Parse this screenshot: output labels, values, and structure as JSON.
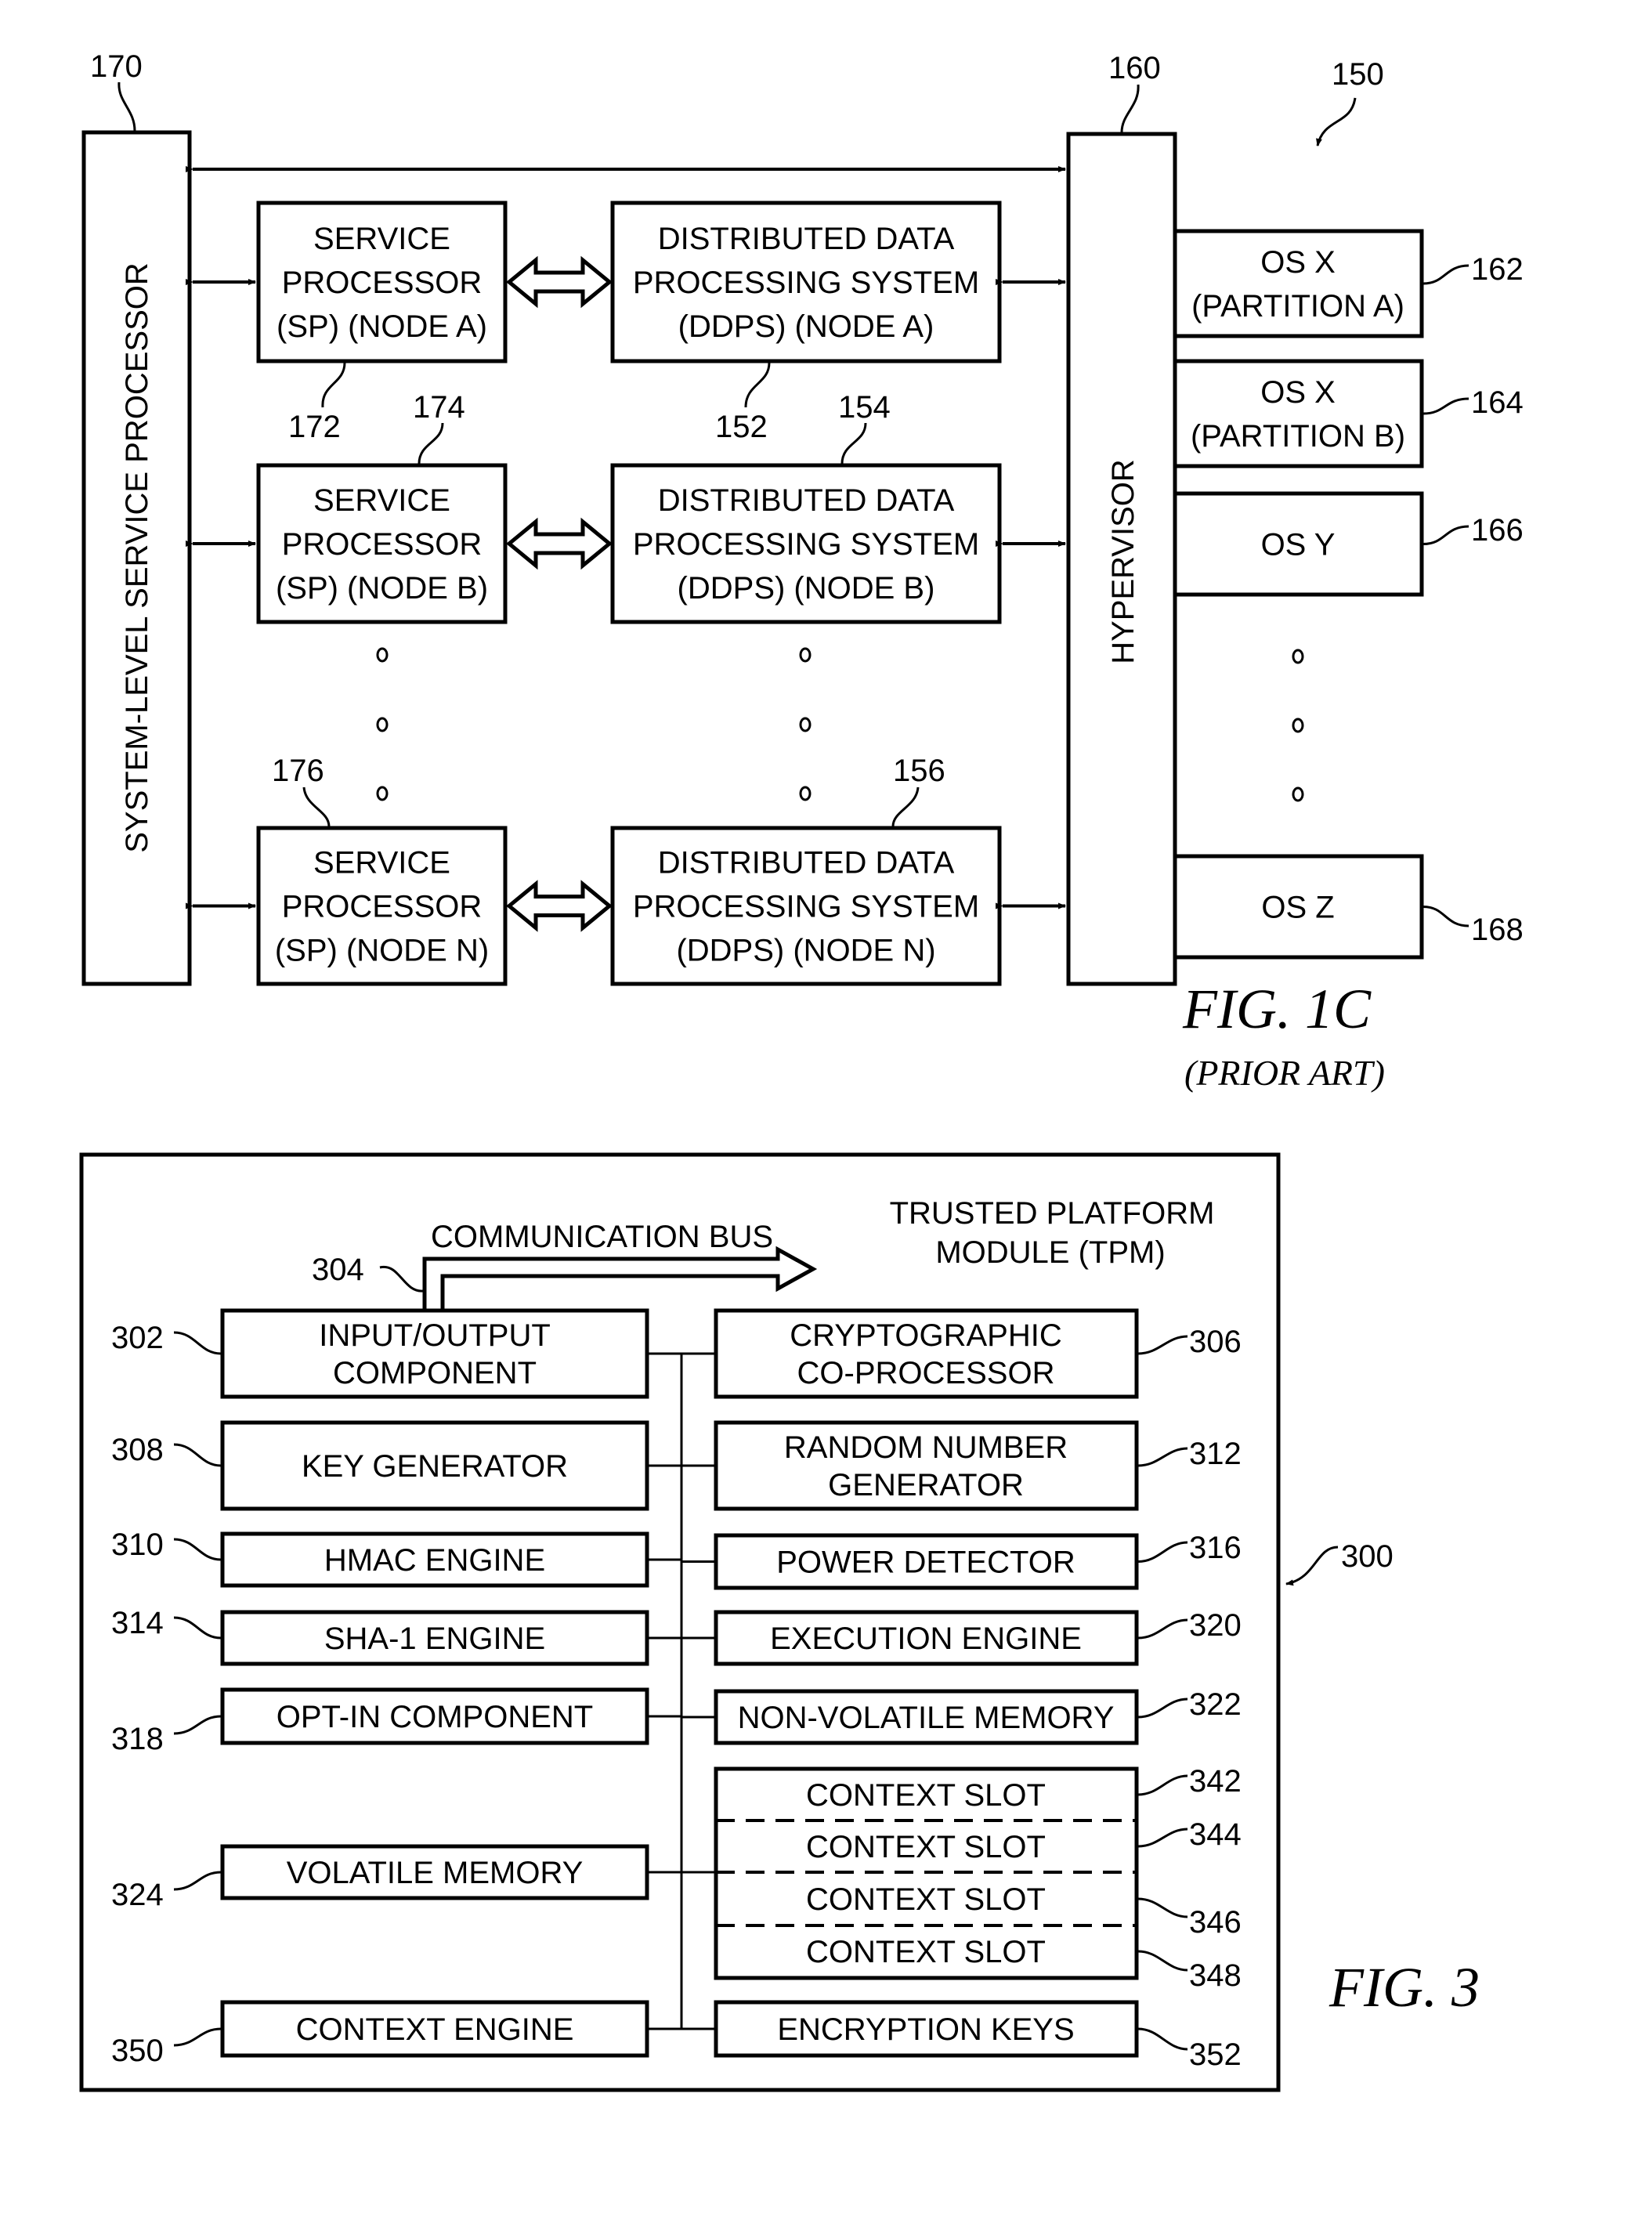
{
  "fig1c": {
    "title": "FIG. 1C",
    "subtitle": "(PRIOR ART)",
    "ref_system": "150",
    "system_level_sp": {
      "ref": "170",
      "label": "SYSTEM-LEVEL SERVICE PROCESSOR"
    },
    "hypervisor": {
      "ref": "160",
      "label": "HYPERVISOR"
    },
    "service_processors": [
      {
        "ref": "172",
        "lines": [
          "SERVICE",
          "PROCESSOR",
          "(SP) (NODE A)"
        ]
      },
      {
        "ref": "174",
        "lines": [
          "SERVICE",
          "PROCESSOR",
          "(SP) (NODE B)"
        ]
      },
      {
        "ref": "176",
        "lines": [
          "SERVICE",
          "PROCESSOR",
          "(SP) (NODE N)"
        ]
      }
    ],
    "ddps": [
      {
        "ref": "152",
        "lines": [
          "DISTRIBUTED DATA",
          "PROCESSING SYSTEM",
          "(DDPS) (NODE A)"
        ]
      },
      {
        "ref": "154",
        "lines": [
          "DISTRIBUTED DATA",
          "PROCESSING SYSTEM",
          "(DDPS) (NODE B)"
        ]
      },
      {
        "ref": "156",
        "lines": [
          "DISTRIBUTED DATA",
          "PROCESSING SYSTEM",
          "(DDPS) (NODE N)"
        ]
      }
    ],
    "partitions": [
      {
        "ref": "162",
        "lines": [
          "OS X",
          "(PARTITION A)"
        ]
      },
      {
        "ref": "164",
        "lines": [
          "OS X",
          "(PARTITION B)"
        ]
      },
      {
        "ref": "166",
        "lines": [
          "OS Y"
        ]
      },
      {
        "ref": "168",
        "lines": [
          "OS Z"
        ]
      }
    ]
  },
  "fig3": {
    "title": "FIG. 3",
    "ref_tpm": "300",
    "tpm_label": [
      "TRUSTED PLATFORM",
      "MODULE (TPM)"
    ],
    "bus": {
      "ref": "304",
      "label": "COMMUNICATION BUS"
    },
    "left_components": [
      {
        "ref": "302",
        "lines": [
          "INPUT/OUTPUT",
          "COMPONENT"
        ]
      },
      {
        "ref": "308",
        "lines": [
          "KEY GENERATOR"
        ]
      },
      {
        "ref": "310",
        "lines": [
          "HMAC ENGINE"
        ]
      },
      {
        "ref": "314",
        "lines": [
          "SHA-1 ENGINE"
        ]
      },
      {
        "ref": "318",
        "lines": [
          "OPT-IN COMPONENT"
        ]
      },
      {
        "ref": "324",
        "lines": [
          "VOLATILE MEMORY"
        ]
      },
      {
        "ref": "350",
        "lines": [
          "CONTEXT ENGINE"
        ]
      }
    ],
    "right_components": [
      {
        "ref": "306",
        "lines": [
          "CRYPTOGRAPHIC",
          "CO-PROCESSOR"
        ]
      },
      {
        "ref": "312",
        "lines": [
          "RANDOM NUMBER",
          "GENERATOR"
        ]
      },
      {
        "ref": "316",
        "lines": [
          "POWER DETECTOR"
        ]
      },
      {
        "ref": "320",
        "lines": [
          "EXECUTION ENGINE"
        ]
      },
      {
        "ref": "322",
        "lines": [
          "NON-VOLATILE MEMORY"
        ]
      },
      {
        "ref": "352",
        "lines": [
          "ENCRYPTION KEYS"
        ]
      }
    ],
    "context_slots": [
      {
        "ref": "342",
        "label": "CONTEXT SLOT"
      },
      {
        "ref": "344",
        "label": "CONTEXT SLOT"
      },
      {
        "ref": "346",
        "label": "CONTEXT SLOT"
      },
      {
        "ref": "348",
        "label": "CONTEXT SLOT"
      }
    ]
  }
}
